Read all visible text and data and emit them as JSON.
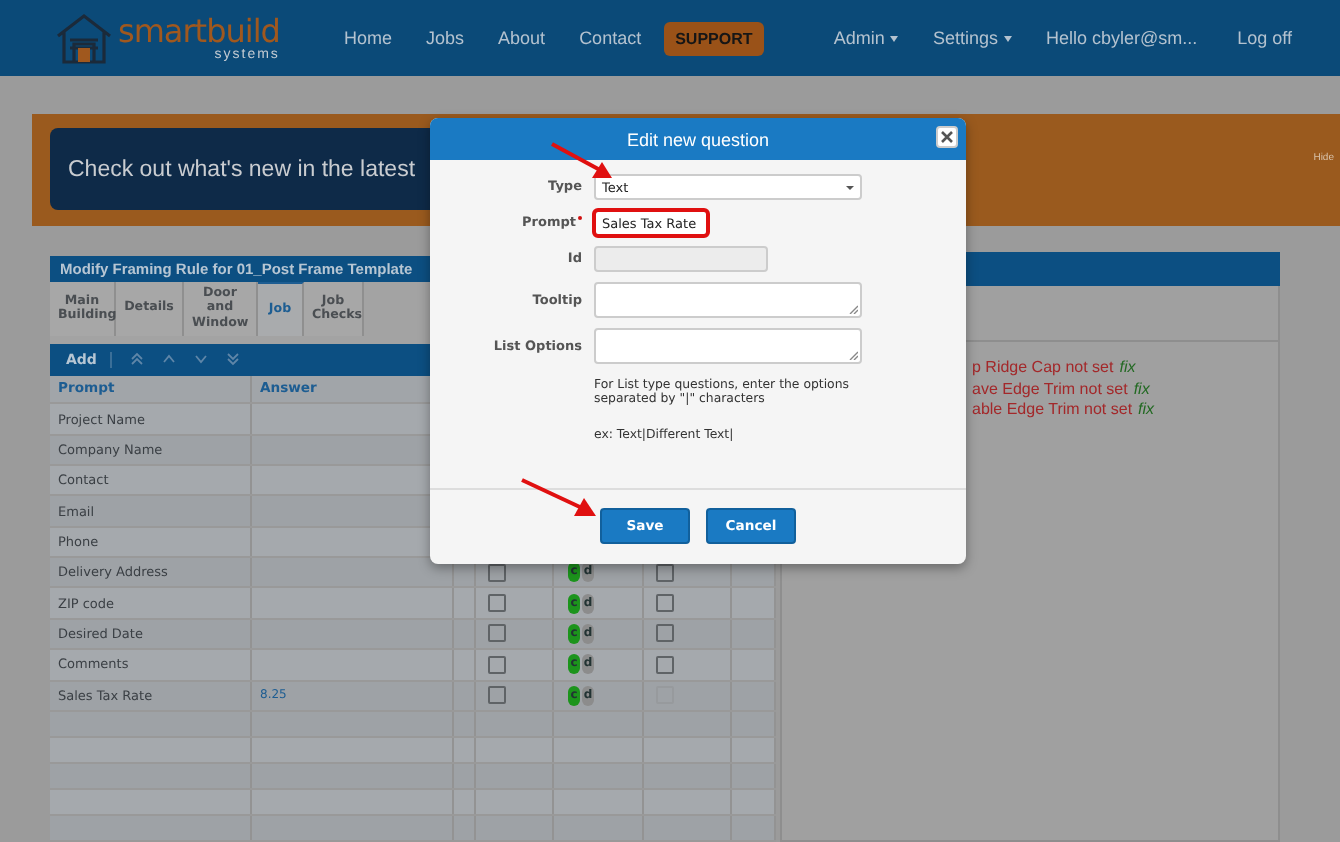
{
  "nav": {
    "logo": {
      "word_1": "smart",
      "word_2": "build",
      "tagline": "systems"
    },
    "links": [
      {
        "label": "Home"
      },
      {
        "label": "Jobs"
      },
      {
        "label": "About"
      },
      {
        "label": "Contact"
      }
    ],
    "support_button": "SUPPORT",
    "menus": [
      {
        "label": "Admin"
      },
      {
        "label": "Settings"
      }
    ],
    "user": "Hello cbyler@sm...",
    "logout": "Log off"
  },
  "banner": {
    "text": "Check out what's new in the latest",
    "hide": "Hide"
  },
  "panel": {
    "title": "Modify Framing Rule for 01_Post Frame Template",
    "tabs": [
      {
        "label": "Main Building",
        "selected": false
      },
      {
        "label": "Details",
        "selected": false
      },
      {
        "label": "Door and Window",
        "selected": false
      },
      {
        "label": "Job",
        "selected": true
      },
      {
        "label": "Job Checks",
        "selected": false
      }
    ],
    "toolbar": {
      "add": "Add"
    },
    "columns": [
      "Prompt",
      "Answer"
    ],
    "rows": [
      {
        "prompt": "Project Name",
        "answer": ""
      },
      {
        "prompt": "Company Name",
        "answer": ""
      },
      {
        "prompt": "Contact",
        "answer": ""
      },
      {
        "prompt": "Email",
        "answer": ""
      },
      {
        "prompt": "Phone",
        "answer": ""
      },
      {
        "prompt": "Delivery Address",
        "answer": "",
        "check_1": {
          "checked": false
        },
        "badges": [
          {
            "label": "c",
            "color": "#1c941c"
          },
          {
            "label": "d",
            "color": "#8c8c8c"
          }
        ],
        "check_2": {
          "checked": false,
          "disabled": false
        }
      },
      {
        "prompt": "ZIP code",
        "answer": "",
        "check_1": {
          "checked": false
        },
        "badges": [
          {
            "label": "c",
            "color": "#1c941c"
          },
          {
            "label": "d",
            "color": "#8c8c8c"
          }
        ],
        "check_2": {
          "checked": false,
          "disabled": false
        }
      },
      {
        "prompt": "Desired Date",
        "answer": "",
        "check_1": {
          "checked": false
        },
        "badges": [
          {
            "label": "c",
            "color": "#1c941c"
          },
          {
            "label": "d",
            "color": "#8c8c8c"
          }
        ],
        "check_2": {
          "checked": false,
          "disabled": false
        }
      },
      {
        "prompt": "Comments",
        "answer": "",
        "check_1": {
          "checked": false
        },
        "badges": [
          {
            "label": "c",
            "color": "#1c941c"
          },
          {
            "label": "d",
            "color": "#8c8c8c"
          }
        ],
        "check_2": {
          "checked": false,
          "disabled": false
        }
      },
      {
        "prompt": "Sales Tax Rate",
        "answer": "8.25",
        "check_1": {
          "checked": false
        },
        "badges": [
          {
            "label": "c",
            "color": "#1c941c"
          },
          {
            "label": "d",
            "color": "#8c8c8c"
          }
        ],
        "check_2": {
          "checked": false,
          "disabled": true
        }
      }
    ]
  },
  "messages": [
    {
      "text": "p Ridge Cap not set",
      "action": "fix"
    },
    {
      "text": "ave Edge Trim not set",
      "action": "fix"
    },
    {
      "text": "able Edge Trim not set",
      "action": "fix"
    }
  ],
  "dialog": {
    "title": "Edit new question",
    "fields": [
      {
        "label": "Type",
        "kind": "select",
        "value": "Text",
        "required": false,
        "disabled": false,
        "highlighted": false
      },
      {
        "label": "Prompt",
        "kind": "text",
        "value": "Sales Tax Rate",
        "required": true,
        "disabled": false,
        "highlighted": true
      },
      {
        "label": "Id",
        "kind": "text",
        "required": false,
        "disabled": true,
        "highlighted": false
      },
      {
        "label": "Tooltip",
        "kind": "textarea",
        "required": false,
        "disabled": false,
        "highlighted": false
      },
      {
        "label": "List Options",
        "kind": "textarea",
        "required": false,
        "disabled": false,
        "highlighted": false
      }
    ],
    "help": "For List type questions, enter the options separated by \"|\" characters",
    "example": "ex: Text|Different Text|",
    "buttons": [
      {
        "label": "Save"
      },
      {
        "label": "Cancel"
      }
    ]
  }
}
